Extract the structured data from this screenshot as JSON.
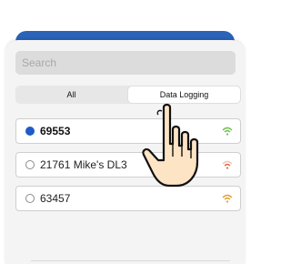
{
  "search": {
    "placeholder": "Search"
  },
  "tabs": [
    {
      "label": "All",
      "active": false
    },
    {
      "label": "Data Logging",
      "active": true
    }
  ],
  "devices": [
    {
      "name": "69553",
      "selected": true,
      "signal": "full"
    },
    {
      "name": "21761 Mike's DL3",
      "selected": false,
      "signal": "weak"
    },
    {
      "name": "63457",
      "selected": false,
      "signal": "medium"
    }
  ],
  "colors": {
    "accent": "#1f5cc9",
    "header": "#2a63b8",
    "wifi_full": "#6cc04a",
    "wifi_weak": "#e06a3c",
    "wifi_medium": "#e0a02a"
  },
  "icons": {
    "wifi": "wifi-signal-icon",
    "pointer": "tap-hand-icon"
  }
}
